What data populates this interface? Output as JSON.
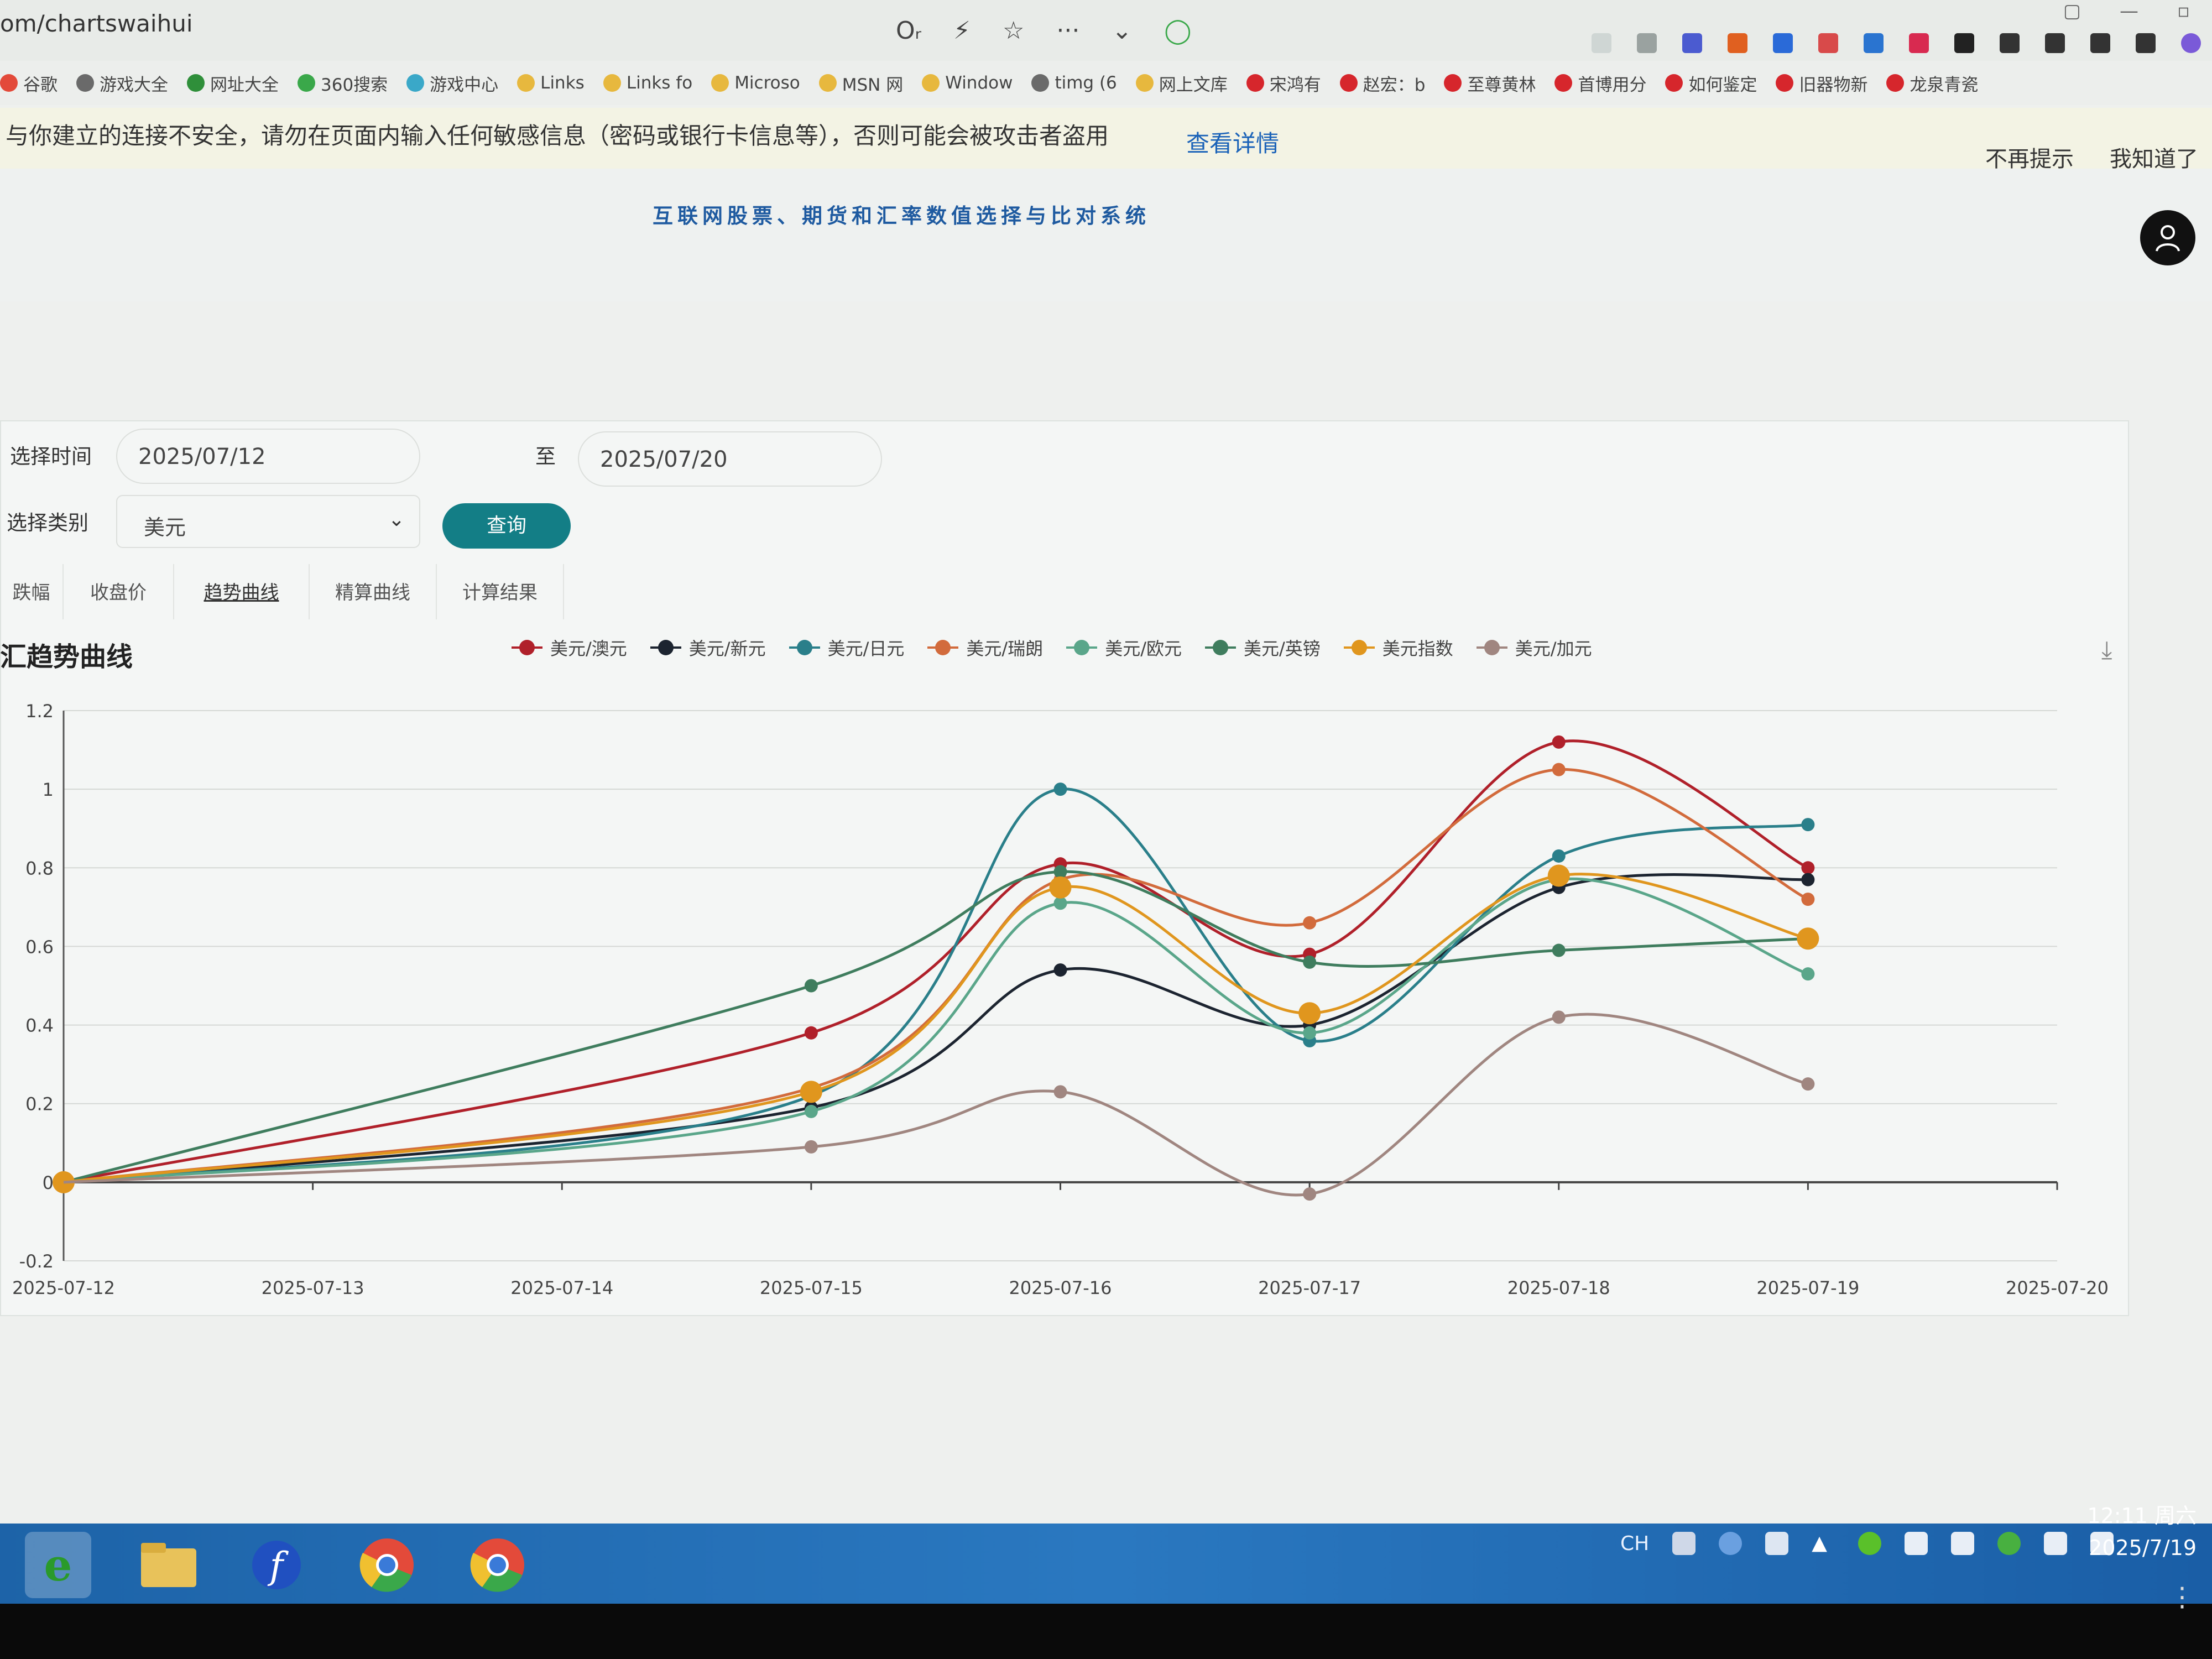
{
  "browser": {
    "url": "om/chartswaihui",
    "toolbar_icons": [
      "key-icon",
      "bolt-icon",
      "star-icon",
      "more-icon",
      "chevron-down-icon",
      "loading-icon"
    ],
    "toolbar_glyphs": [
      "Oᵣ",
      "⚡",
      "☆",
      "···",
      "⌄",
      "◯"
    ],
    "window_controls": [
      "▢",
      "—",
      "▫"
    ]
  },
  "bookmarks": [
    {
      "label": "谷歌",
      "color": "#e34a3a"
    },
    {
      "label": "游戏大全",
      "color": "#6a6a6a"
    },
    {
      "label": "网址大全",
      "color": "#2f8f3a"
    },
    {
      "label": "360搜索",
      "color": "#3aa84a"
    },
    {
      "label": "游戏中心",
      "color": "#3aa8c8"
    },
    {
      "label": "Links",
      "color": "#e7b83e"
    },
    {
      "label": "Links fo",
      "color": "#e7b83e"
    },
    {
      "label": "Microso",
      "color": "#e7b83e"
    },
    {
      "label": "MSN 网",
      "color": "#e7b83e"
    },
    {
      "label": "Window",
      "color": "#e7b83e"
    },
    {
      "label": "timg (6",
      "color": "#6a6a6a"
    },
    {
      "label": "网上文库",
      "color": "#e7b83e"
    },
    {
      "label": "宋鸿有",
      "color": "#d6262c"
    },
    {
      "label": "赵宏：b",
      "color": "#d6262c"
    },
    {
      "label": "至尊黄林",
      "color": "#d6262c"
    },
    {
      "label": "首博用分",
      "color": "#d6262c"
    },
    {
      "label": "如何鉴定",
      "color": "#d6262c"
    },
    {
      "label": "旧器物新",
      "color": "#d6262c"
    },
    {
      "label": "龙泉青瓷",
      "color": "#d6262c"
    }
  ],
  "warning": {
    "text": "与你建立的连接不安全，请勿在页面内输入任何敏感信息（密码或银行卡信息等），否则可能会被攻击者盗用",
    "link": "查看详情",
    "dismiss": "不再提示",
    "ok": "我知道了"
  },
  "site": {
    "title": "互联网股票、期货和汇率数值选择与比对系统"
  },
  "form": {
    "time_label": "选择时间",
    "start_date": "2025/07/12",
    "to_label": "至",
    "end_date": "2025/07/20",
    "category_label": "选择类别",
    "category_value": "美元",
    "query_button": "查询"
  },
  "tabs": [
    "跌幅",
    "收盘价",
    "趋势曲线",
    "精算曲线",
    "计算结果"
  ],
  "active_tab": "趋势曲线",
  "chart_title": "汇趋势曲线",
  "chart_data": {
    "type": "line",
    "title": "汇趋势曲线",
    "xlabel": "",
    "ylabel": "",
    "categories": [
      "2025-07-12",
      "2025-07-13",
      "2025-07-14",
      "2025-07-15",
      "2025-07-16",
      "2025-07-17",
      "2025-07-18",
      "2025-07-19",
      "2025-07-20"
    ],
    "yticks": [
      "1.2",
      "1",
      "0.8",
      "0.6",
      "0.4",
      "0.2",
      "0",
      "-0.2"
    ],
    "ylim": [
      -0.2,
      1.2
    ],
    "grid": true,
    "legend_position": "top",
    "smooth": true,
    "series": [
      {
        "name": "美元/澳元",
        "color": "#b0202a",
        "values": [
          0,
          null,
          null,
          0.38,
          0.81,
          0.58,
          1.12,
          0.8,
          null
        ]
      },
      {
        "name": "美元/新元",
        "color": "#1c2430",
        "values": [
          0,
          null,
          null,
          0.19,
          0.54,
          0.4,
          0.75,
          0.77,
          null
        ]
      },
      {
        "name": "美元/日元",
        "color": "#2a7f8a",
        "values": [
          0,
          null,
          null,
          0.22,
          1.0,
          0.36,
          0.83,
          0.91,
          null
        ]
      },
      {
        "name": "美元/瑞朗",
        "color": "#d26b3c",
        "values": [
          0,
          null,
          null,
          0.24,
          0.77,
          0.66,
          1.05,
          0.72,
          null
        ]
      },
      {
        "name": "美元/欧元",
        "color": "#5aa68a",
        "values": [
          0,
          null,
          null,
          0.18,
          0.71,
          0.38,
          0.77,
          0.53,
          null
        ]
      },
      {
        "name": "美元/英镑",
        "color": "#3f7d5e",
        "values": [
          0,
          null,
          null,
          0.5,
          0.79,
          0.56,
          0.59,
          0.62,
          null
        ]
      },
      {
        "name": "美元指数",
        "color": "#e0961e",
        "values": [
          0,
          null,
          null,
          0.23,
          0.75,
          0.43,
          0.78,
          0.62,
          null
        ]
      },
      {
        "name": "美元/加元",
        "color": "#a08680",
        "values": [
          0,
          null,
          null,
          0.09,
          0.23,
          -0.03,
          0.42,
          0.25,
          null
        ]
      }
    ]
  },
  "taskbar": {
    "apps": [
      "ie-icon",
      "file-explorer-icon",
      "flash-icon",
      "chrome-icon",
      "chrome-icon"
    ],
    "tray_lang": "CH",
    "time": "12:11 周六",
    "date": "2025/7/19"
  }
}
